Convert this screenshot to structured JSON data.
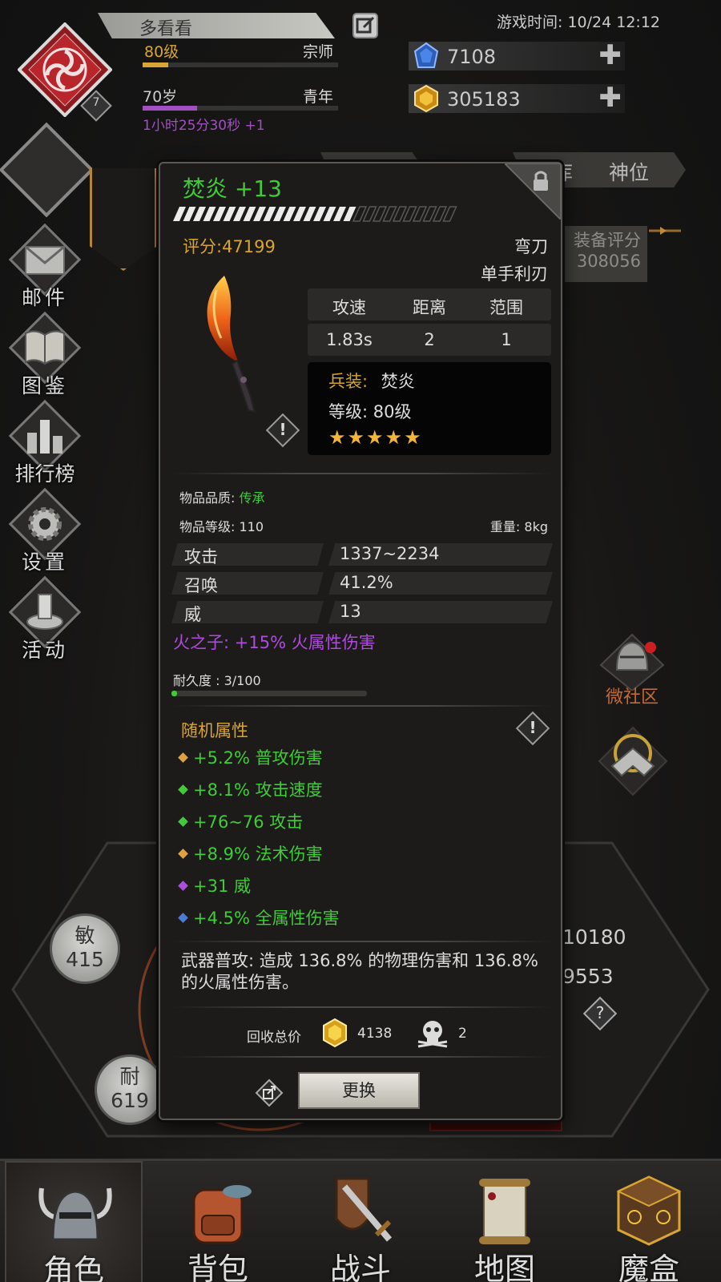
{
  "player": {
    "name": "多看看",
    "emblem_badge": "7",
    "level_label": "80级",
    "rank_label": "宗师",
    "level_progress": 0.13,
    "age_label": "70岁",
    "age_stage": "青年",
    "age_progress": 0.28,
    "timer": "1小时25分30秒 +1"
  },
  "header": {
    "game_time": "游戏时间: 10/24 12:12",
    "diamonds": "7108",
    "gold": "305183"
  },
  "sidebar": {
    "items": [
      {
        "label": "邮件",
        "icon": "mail-icon"
      },
      {
        "label": "图鉴",
        "icon": "book-icon"
      },
      {
        "label": "排行榜",
        "icon": "ranking-icon"
      },
      {
        "label": "设置",
        "icon": "gear-icon"
      },
      {
        "label": "活动",
        "icon": "activity-icon"
      }
    ]
  },
  "background": {
    "tabs": [
      "库",
      "神位"
    ],
    "equip_score_label": "装备评分",
    "equip_score": "308056",
    "social_label": "微社区",
    "stat_a": "10180",
    "stat_b": "9553",
    "agi_label": "敏",
    "agi_value": "415",
    "end_label": "耐",
    "end_value": "619"
  },
  "item": {
    "name": "焚炎 +13",
    "enhance_progress": 0.65,
    "score": "评分:47199",
    "weapon_type": "弯刀",
    "weapon_class": "单手利刃",
    "stats_headers": [
      "攻速",
      "距离",
      "范围"
    ],
    "stats_values": [
      "1.83s",
      "2",
      "1"
    ],
    "armament_label": "兵装:",
    "armament_value": "焚炎",
    "grade_label": "等级:",
    "grade_value": "80级",
    "stars": "★★★★★",
    "quality_label": "物品品质:",
    "quality_value": "传承",
    "item_level": "物品等级: 110",
    "weight": "重量: 8kg",
    "attributes": [
      {
        "key": "攻击",
        "value": "1337~2234"
      },
      {
        "key": "召唤",
        "value": "41.2%"
      },
      {
        "key": "威",
        "value": "13"
      }
    ],
    "passive": "火之子: +15% 火属性伤害",
    "durability_label": "耐久度 : 3/100",
    "durability": 0.03,
    "random_title": "随机属性",
    "random_attrs": [
      {
        "text": "+5.2% 普攻伤害",
        "color": "#e0a040"
      },
      {
        "text": "+8.1% 攻击速度",
        "color": "#3fcc37"
      },
      {
        "text": "+76~76 攻击",
        "color": "#3fcc37"
      },
      {
        "text": "+8.9% 法术伤害",
        "color": "#e0a040"
      },
      {
        "text": "+31 威",
        "color": "#b04be0"
      },
      {
        "text": "+4.5% 全属性伤害",
        "color": "#4a7bd8"
      }
    ],
    "description": "武器普攻: 造成 136.8% 的物理伤害和 136.8% 的火属性伤害。",
    "recycle_label": "回收总价",
    "recycle_gold": "4138",
    "recycle_skull": "2",
    "replace_button": "更换"
  },
  "nav": {
    "items": [
      {
        "label": "角色",
        "icon": "helmet-icon"
      },
      {
        "label": "背包",
        "icon": "backpack-icon"
      },
      {
        "label": "战斗",
        "icon": "sword-shield-icon"
      },
      {
        "label": "地图",
        "icon": "scroll-map-icon"
      },
      {
        "label": "魔盒",
        "icon": "magic-box-icon"
      }
    ]
  },
  "colors": {
    "green": "#3fcc37",
    "gold": "#d8a530",
    "purple": "#b04be0",
    "emblem": "#b8252b"
  }
}
